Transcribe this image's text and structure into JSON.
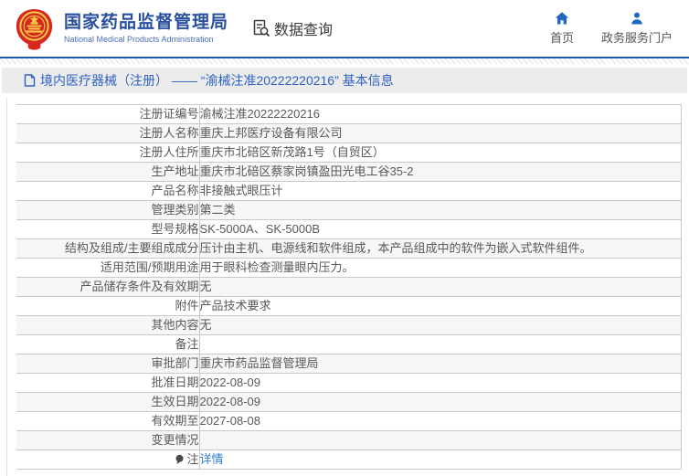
{
  "header": {
    "agency_name": "国家药品监督管理局",
    "agency_name_en": "National Medical Products Administration",
    "data_query": "数据查询",
    "nav_home": "首页",
    "nav_portal": "政务服务门户"
  },
  "breadcrumb": {
    "text": "境内医疗器械（注册） —— “渝械注准20222220216” 基本信息"
  },
  "detail_table": {
    "rows": [
      {
        "label": "注册证编号",
        "value": "渝械注准20222220216"
      },
      {
        "label": "注册人名称",
        "value": "重庆上邦医疗设备有限公司"
      },
      {
        "label": "注册人住所",
        "value": "重庆市北碚区新茂路1号（自贸区）"
      },
      {
        "label": "生产地址",
        "value": "重庆市北碚区蔡家岗镇盈田光电工谷35-2"
      },
      {
        "label": "产品名称",
        "value": "非接触式眼压计"
      },
      {
        "label": "管理类别",
        "value": "第二类"
      },
      {
        "label": "型号规格",
        "value": "SK-5000A、SK-5000B"
      },
      {
        "label": "结构及组成/主要组成成分",
        "value": "压计由主机、电源线和软件组成，本产品组成中的软件为嵌入式软件组件。"
      },
      {
        "label": "适用范围/预期用途",
        "value": "用于眼科检查测量眼内压力。"
      },
      {
        "label": "产品储存条件及有效期",
        "value": "无"
      },
      {
        "label": "附件",
        "value": "产品技术要求"
      },
      {
        "label": "其他内容",
        "value": "无"
      },
      {
        "label": "备注",
        "value": ""
      },
      {
        "label": "审批部门",
        "value": "重庆市药品监督管理局"
      },
      {
        "label": "批准日期",
        "value": "2022-08-09"
      },
      {
        "label": "生效日期",
        "value": "2022-08-09"
      },
      {
        "label": "有效期至",
        "value": "2027-08-08"
      },
      {
        "label": "变更情况",
        "value": ""
      },
      {
        "label": "注",
        "value": "详情",
        "value_is_link": true,
        "label_icon": "note-balloon-icon"
      }
    ]
  },
  "colors": {
    "header_blue": "#28509e",
    "line_blue": "#1e5aa9",
    "breadcrumb_blue": "#2f62c5",
    "link_blue": "#2e7fd0",
    "nav_icon_blue": "#1f66c1",
    "emblem_red": "#d6281e",
    "emblem_gold": "#f7c948"
  }
}
